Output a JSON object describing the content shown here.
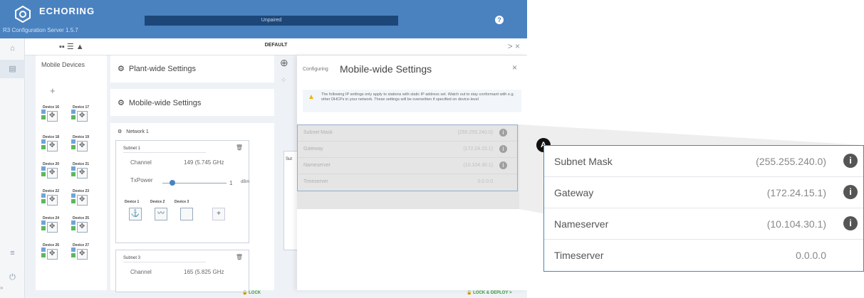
{
  "header": {
    "brand": "ECHORING",
    "subtitle": "R3 Configuration Server 1.5.7",
    "status": "Unpaired",
    "help_icon": "help-circle-icon"
  },
  "toolbar": {
    "title": "DEFAULT",
    "view_icons": "▪▪ ☰ ▲",
    "right_controls": "> ×"
  },
  "devices": {
    "title": "Mobile Devices",
    "add_label": "+",
    "rows": [
      {
        "a": "Device 16",
        "b": "Device 17"
      },
      {
        "a": "Device 18",
        "b": "Device 19"
      },
      {
        "a": "Device 20",
        "b": "Device 21"
      },
      {
        "a": "Device 22",
        "b": "Device 23"
      },
      {
        "a": "Device 24",
        "b": "Device 25"
      },
      {
        "a": "Device 26",
        "b": "Device 27"
      }
    ]
  },
  "settings": {
    "plant": "Plant-wide Settings",
    "mobile": "Mobile-wide Settings",
    "network": "Network 1",
    "subnet1": {
      "title": "Subnet 1",
      "channel_label": "Channel",
      "channel_value": "149 (5.745 GHz",
      "txpower_label": "TxPower",
      "txpower_value": "1",
      "txpower_unit": "dBm",
      "devices": [
        "Device 1",
        "Device 2",
        "Device 3"
      ],
      "add": "+"
    },
    "subnet3": {
      "title": "Subnet 3",
      "channel_label": "Channel",
      "channel_value": "165 (5.825 GHz"
    },
    "partial_sub": "Sut"
  },
  "modal": {
    "configuring": "Configuring",
    "title": "Mobile-wide Settings",
    "close": "×",
    "warning": "The following IP settings only apply to stations with static IP address set. Watch out to stay conformant with e.g. other DHCPs in your network. These settings will be overwritten if specified on device-level",
    "fields": [
      {
        "label": "Subnet Mask",
        "value": "(255.255.240.0)",
        "info": true
      },
      {
        "label": "Gateway",
        "value": "(172.24.15.1)",
        "info": true
      },
      {
        "label": "Nameserver",
        "value": "(10.104.30.1)",
        "info": true
      },
      {
        "label": "Timeserver",
        "value": "0.0.0.0",
        "info": false
      }
    ]
  },
  "footer": {
    "lock": "LOCK",
    "lock_deploy": "LOCK & DEPLOY >"
  },
  "zoom": {
    "badge": "A",
    "fields": [
      {
        "label": "Subnet Mask",
        "value": "(255.255.240.0)"
      },
      {
        "label": "Gateway",
        "value": "(172.24.15.1)"
      },
      {
        "label": "Nameserver",
        "value": "(10.104.30.1)"
      },
      {
        "label": "Timeserver",
        "value": "0.0.0.0"
      }
    ]
  },
  "colors": {
    "header": "#4a82c0",
    "status_bar": "#1d4778",
    "accent_green": "#3a9a3a"
  }
}
